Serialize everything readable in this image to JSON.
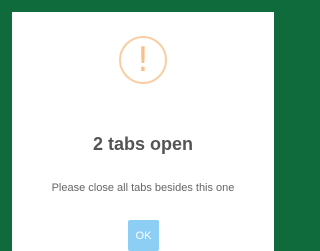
{
  "dialog": {
    "icon": "exclamation-icon",
    "icon_glyph": "!",
    "title": "2 tabs open",
    "message": "Please close all tabs besides this one",
    "ok_label": "OK"
  },
  "colors": {
    "background": "#0f6b3c",
    "dialog_bg": "#ffffff",
    "icon_border": "#f8cfa4",
    "icon_color": "#f8bf87",
    "button_bg": "#8dcff4"
  }
}
